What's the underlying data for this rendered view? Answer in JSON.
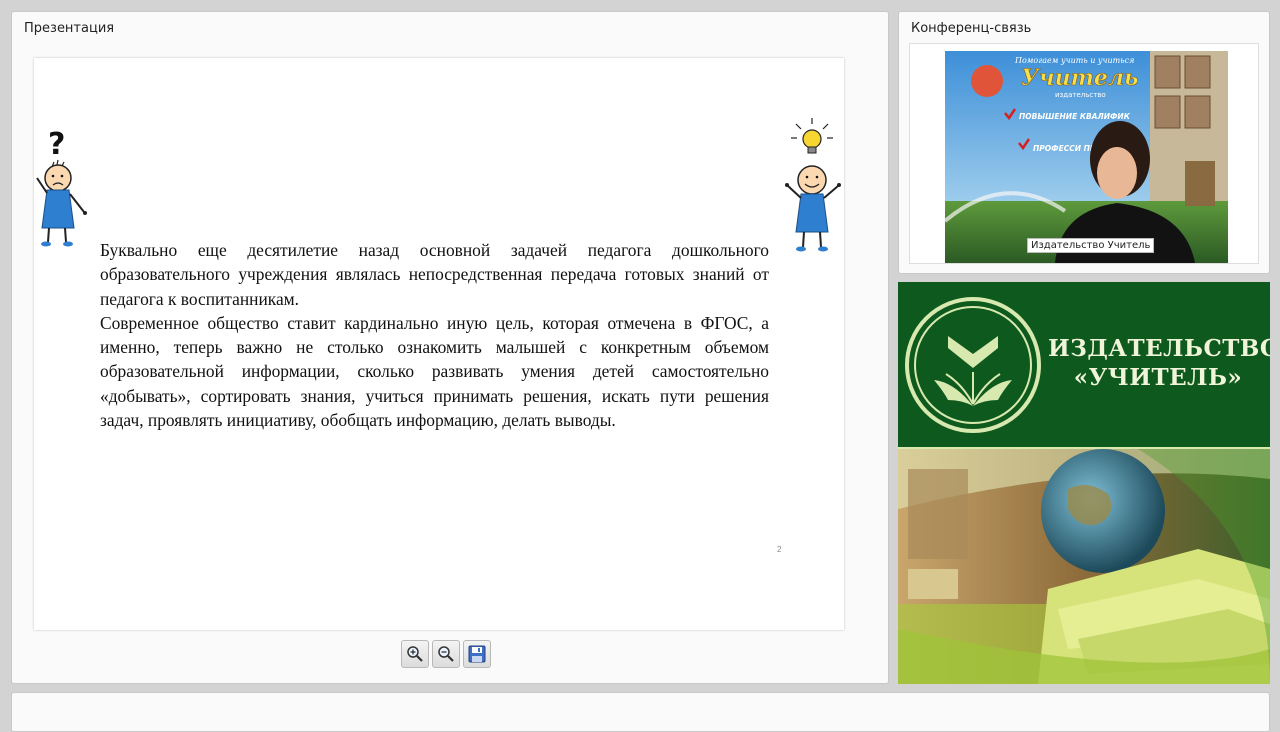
{
  "presentation": {
    "title": "Презентация",
    "slide": {
      "paragraphs": [
        "Буквально еще десятилетие назад основной задачей педагога дошкольного образовательного учреждения являлась непосредственная передача готовых знаний от педагога к воспитанникам.",
        "Современное общество ставит кардинально иную цель, которая отмечена в ФГОС, а именно, теперь важно не столько ознакомить малышей с конкретным объемом образовательной информации, сколько развивать умения детей самостоятельно «добывать», сортировать знания, учиться принимать решения, искать пути решения задач, проявлять инициативу, обобщать информацию, делать выводы."
      ],
      "page_mark": "2"
    },
    "toolbar": {
      "zoom_in_icon": "zoom-in-icon",
      "zoom_out_icon": "zoom-out-icon",
      "save_icon": "save-icon"
    }
  },
  "conference": {
    "title": "Конференц-связь",
    "participant_label": "Издательство Учитель",
    "banner_text": {
      "top": "Помогаем учить и учиться",
      "logo": "Учитель",
      "sub": "издательство",
      "bullet1": "ПОВЫШЕНИЕ КВАЛИФИК",
      "bullet2": "ПРОФЕССИ ПЕРЕП"
    }
  },
  "publisher": {
    "name_line1": "ИЗДАТЕЛЬСТВО",
    "name_line2": "«УЧИТЕЛЬ»"
  },
  "colors": {
    "brand_green": "#0e5a1e",
    "brand_text": "#f0f4d8",
    "accent_yellow": "#f2d43a"
  }
}
